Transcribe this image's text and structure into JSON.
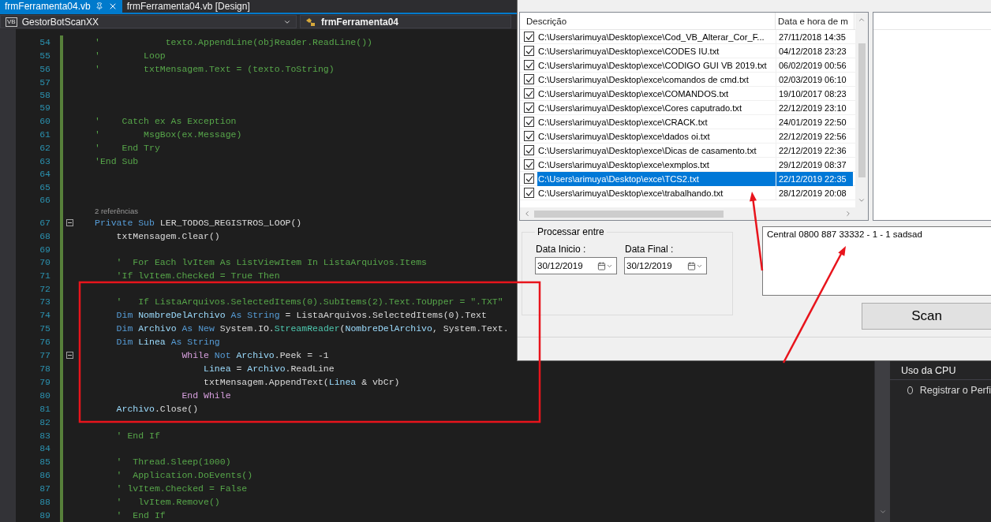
{
  "editor_tabs": [
    {
      "label": "frmFerramenta04.vb",
      "selected": true
    },
    {
      "label": "frmFerramenta04.vb [Design]",
      "selected": false
    }
  ],
  "nav": {
    "project_badge": "VB",
    "project": "GestorBotScanXX",
    "class_name": "frmFerramenta04"
  },
  "code_lines": [
    {
      "kind": "code",
      "number": "54",
      "fold": false,
      "tokens": [
        {
          "text": "'            texto.AppendLine(objReader.ReadLine())",
          "kind": "comment"
        }
      ]
    },
    {
      "kind": "code",
      "number": "55",
      "fold": false,
      "tokens": [
        {
          "text": "'        Loop",
          "kind": "comment"
        }
      ]
    },
    {
      "kind": "code",
      "number": "56",
      "fold": false,
      "tokens": [
        {
          "text": "'        txtMensagem.Text = (texto.ToString)",
          "kind": "comment"
        }
      ]
    },
    {
      "kind": "code",
      "number": "57",
      "fold": false
    },
    {
      "kind": "code",
      "number": "58",
      "fold": false
    },
    {
      "kind": "code",
      "number": "59",
      "fold": false
    },
    {
      "kind": "code",
      "number": "60",
      "fold": false,
      "tokens": [
        {
          "text": "'    Catch ex As Exception",
          "kind": "comment"
        }
      ]
    },
    {
      "kind": "code",
      "number": "61",
      "fold": false,
      "tokens": [
        {
          "text": "'        MsgBox(ex.Message)",
          "kind": "comment"
        }
      ]
    },
    {
      "kind": "code",
      "number": "62",
      "fold": false,
      "tokens": [
        {
          "text": "'    End Try",
          "kind": "comment"
        }
      ]
    },
    {
      "kind": "code",
      "number": "63",
      "fold": false,
      "tokens": [
        {
          "text": "'End Sub",
          "kind": "comment"
        }
      ]
    },
    {
      "kind": "code",
      "number": "64",
      "fold": false
    },
    {
      "kind": "code",
      "number": "65",
      "fold": false
    },
    {
      "kind": "code",
      "number": "66",
      "fold": false
    },
    {
      "kind": "lens",
      "text": "2 referências"
    },
    {
      "kind": "code",
      "number": "67",
      "fold": true,
      "tokens": [
        {
          "text": "Private Sub ",
          "kind": "keyword"
        },
        {
          "text": "LER_TODOS_REGISTROS_LOOP()",
          "kind": "plain"
        }
      ]
    },
    {
      "kind": "code",
      "number": "68",
      "fold": false,
      "tokens": [
        {
          "text": "    txtMensagem.Clear()",
          "kind": "plain"
        }
      ]
    },
    {
      "kind": "code",
      "number": "69",
      "fold": false
    },
    {
      "kind": "code",
      "number": "70",
      "fold": false,
      "tokens": [
        {
          "text": "    '  For Each lvItem As ListViewItem In ListaArquivos.Items",
          "kind": "comment"
        }
      ]
    },
    {
      "kind": "code",
      "number": "71",
      "fold": false,
      "tokens": [
        {
          "text": "    'If lvItem.Checked = True Then",
          "kind": "comment"
        }
      ]
    },
    {
      "kind": "code",
      "number": "72",
      "fold": false
    },
    {
      "kind": "code",
      "number": "73",
      "fold": false,
      "tokens": [
        {
          "text": "    '   If ListaArquivos.SelectedItems(0).SubItems(2).Text.ToUpper = \".TXT\"",
          "kind": "comment"
        }
      ]
    },
    {
      "kind": "code",
      "number": "74",
      "fold": false,
      "tokens": [
        {
          "text": "    Dim ",
          "kind": "keyword"
        },
        {
          "text": "NombreDelArchivo",
          "kind": "variable"
        },
        {
          "text": " As ",
          "kind": "keyword"
        },
        {
          "text": "String",
          "kind": "keyword"
        },
        {
          "text": " = ListaArquivos.SelectedItems(0).Text",
          "kind": "plain"
        }
      ]
    },
    {
      "kind": "code",
      "number": "75",
      "fold": false,
      "tokens": [
        {
          "text": "    Dim ",
          "kind": "keyword"
        },
        {
          "text": "Archivo",
          "kind": "variable"
        },
        {
          "text": " As New ",
          "kind": "keyword"
        },
        {
          "text": "System.IO.",
          "kind": "plain"
        },
        {
          "text": "StreamReader",
          "kind": "type"
        },
        {
          "text": "(",
          "kind": "plain"
        },
        {
          "text": "NombreDelArchivo",
          "kind": "variable"
        },
        {
          "text": ", System.Text.",
          "kind": "plain"
        }
      ]
    },
    {
      "kind": "code",
      "number": "76",
      "fold": false,
      "tokens": [
        {
          "text": "    Dim ",
          "kind": "keyword"
        },
        {
          "text": "Linea",
          "kind": "variable"
        },
        {
          "text": " As ",
          "kind": "keyword"
        },
        {
          "text": "String",
          "kind": "keyword"
        }
      ]
    },
    {
      "kind": "code",
      "number": "77",
      "fold": true,
      "tokens": [
        {
          "text": "                While ",
          "kind": "control"
        },
        {
          "text": "Not ",
          "kind": "keyword"
        },
        {
          "text": "Archivo",
          "kind": "variable"
        },
        {
          "text": ".Peek = -1",
          "kind": "plain"
        }
      ]
    },
    {
      "kind": "code",
      "number": "78",
      "fold": false,
      "tokens": [
        {
          "text": "                    Linea",
          "kind": "variable"
        },
        {
          "text": " = ",
          "kind": "plain"
        },
        {
          "text": "Archivo",
          "kind": "variable"
        },
        {
          "text": ".ReadLine",
          "kind": "plain"
        }
      ]
    },
    {
      "kind": "code",
      "number": "79",
      "fold": false,
      "tokens": [
        {
          "text": "                    txtMensagem.AppendText(",
          "kind": "plain"
        },
        {
          "text": "Linea",
          "kind": "variable"
        },
        {
          "text": " & vbCr)",
          "kind": "plain"
        }
      ]
    },
    {
      "kind": "code",
      "number": "80",
      "fold": false,
      "tokens": [
        {
          "text": "                End While",
          "kind": "control"
        }
      ]
    },
    {
      "kind": "code",
      "number": "81",
      "fold": false,
      "tokens": [
        {
          "text": "    Archivo",
          "kind": "variable"
        },
        {
          "text": ".Close()",
          "kind": "plain"
        }
      ]
    },
    {
      "kind": "code",
      "number": "82",
      "fold": false
    },
    {
      "kind": "code",
      "number": "83",
      "fold": false,
      "tokens": [
        {
          "text": "    ' End If",
          "kind": "comment"
        }
      ]
    },
    {
      "kind": "code",
      "number": "84",
      "fold": false
    },
    {
      "kind": "code",
      "number": "85",
      "fold": false,
      "tokens": [
        {
          "text": "    '  Thread.Sleep(1000)",
          "kind": "comment"
        }
      ]
    },
    {
      "kind": "code",
      "number": "86",
      "fold": false,
      "tokens": [
        {
          "text": "    '  Application.DoEvents()",
          "kind": "comment"
        }
      ]
    },
    {
      "kind": "code",
      "number": "87",
      "fold": false,
      "tokens": [
        {
          "text": "    ' lvItem.Checked = False",
          "kind": "comment"
        }
      ]
    },
    {
      "kind": "code",
      "number": "88",
      "fold": false,
      "tokens": [
        {
          "text": "    '   lvItem.Remove()",
          "kind": "comment"
        }
      ]
    },
    {
      "kind": "code",
      "number": "89",
      "fold": false,
      "tokens": [
        {
          "text": "    '  End If",
          "kind": "comment"
        }
      ]
    }
  ],
  "form": {
    "list": {
      "columns": [
        "Descrição",
        "Data e hora de m"
      ],
      "rows": [
        {
          "path": "C:\\Users\\arimuya\\Desktop\\exce\\Cod_VB_Alterar_Cor_F...",
          "date": "27/11/2018 14:35",
          "checked": true,
          "selected": false
        },
        {
          "path": "C:\\Users\\arimuya\\Desktop\\exce\\CODES IU.txt",
          "date": "04/12/2018 23:23",
          "checked": true,
          "selected": false
        },
        {
          "path": "C:\\Users\\arimuya\\Desktop\\exce\\CODIGO GUI VB 2019.txt",
          "date": "06/02/2019 00:56",
          "checked": true,
          "selected": false
        },
        {
          "path": "C:\\Users\\arimuya\\Desktop\\exce\\comandos de cmd.txt",
          "date": "02/03/2019 06:10",
          "checked": true,
          "selected": false
        },
        {
          "path": "C:\\Users\\arimuya\\Desktop\\exce\\COMANDOS.txt",
          "date": "19/10/2017 08:23",
          "checked": true,
          "selected": false
        },
        {
          "path": "C:\\Users\\arimuya\\Desktop\\exce\\Cores caputrado.txt",
          "date": "22/12/2019 23:10",
          "checked": true,
          "selected": false
        },
        {
          "path": "C:\\Users\\arimuya\\Desktop\\exce\\CRACK.txt",
          "date": "24/01/2019 22:50",
          "checked": true,
          "selected": false
        },
        {
          "path": "C:\\Users\\arimuya\\Desktop\\exce\\dados oi.txt",
          "date": "22/12/2019 22:56",
          "checked": true,
          "selected": false
        },
        {
          "path": "C:\\Users\\arimuya\\Desktop\\exce\\Dicas de casamento.txt",
          "date": "22/12/2019 22:36",
          "checked": true,
          "selected": false
        },
        {
          "path": "C:\\Users\\arimuya\\Desktop\\exce\\exmplos.txt",
          "date": "29/12/2019 08:37",
          "checked": true,
          "selected": false
        },
        {
          "path": "C:\\Users\\arimuya\\Desktop\\exce\\TCS2.txt",
          "date": "22/12/2019 22:35",
          "checked": true,
          "selected": true
        },
        {
          "path": "C:\\Users\\arimuya\\Desktop\\exce\\trabalhando.txt",
          "date": "28/12/2019 20:08",
          "checked": true,
          "selected": false
        }
      ]
    },
    "group": {
      "title": "Processar entre",
      "fields": [
        {
          "label": "Data Inicio :",
          "value": "30/12/2019"
        },
        {
          "label": "Data Final :",
          "value": "30/12/2019"
        }
      ]
    },
    "message": {
      "value": "Central 0800 887 33332 - 1 - 1 sadsad"
    },
    "scan_button": "Scan"
  },
  "diagnostics": {
    "title": "Uso da CPU",
    "option": {
      "label": "Registrar o Perfi",
      "selected": false
    }
  }
}
